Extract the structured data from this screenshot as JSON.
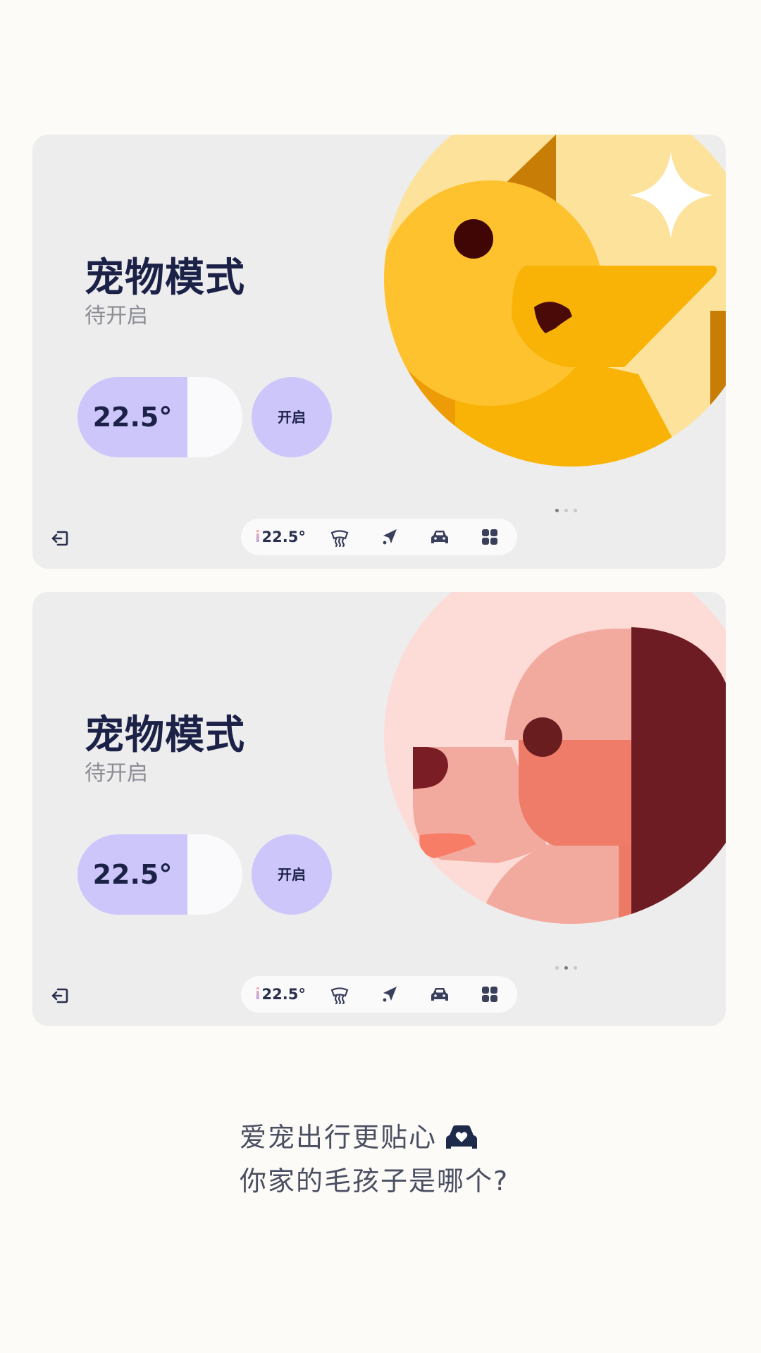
{
  "cards": [
    {
      "pet": "duck",
      "title": "宠物模式",
      "status": "待开启",
      "temperature": "22.5°",
      "on_button_label": "开启",
      "page_dots": {
        "count": 3,
        "active": 0
      },
      "dock": {
        "temperature": "22.5°",
        "icons": [
          "defrost-icon",
          "navigation-icon",
          "car-icon",
          "apps-grid-icon"
        ]
      }
    },
    {
      "pet": "dog",
      "title": "宠物模式",
      "status": "待开启",
      "temperature": "22.5°",
      "on_button_label": "开启",
      "page_dots": {
        "count": 3,
        "active": 1
      },
      "dock": {
        "temperature": "22.5°",
        "icons": [
          "defrost-icon",
          "navigation-icon",
          "car-icon",
          "apps-grid-icon"
        ]
      }
    }
  ],
  "tagline": {
    "line1": "爱宠出行更贴心",
    "line2": "你家的毛孩子是哪个?"
  },
  "colors": {
    "page_background": "#fcfbf7",
    "card_background": "#ededee",
    "accent_lavender": "#cdc6fb",
    "text_navy": "#1c2147",
    "duck_yellow": "#fec22f",
    "dog_pink": "#f3aa9e",
    "dog_maroon": "#6e1c24"
  }
}
